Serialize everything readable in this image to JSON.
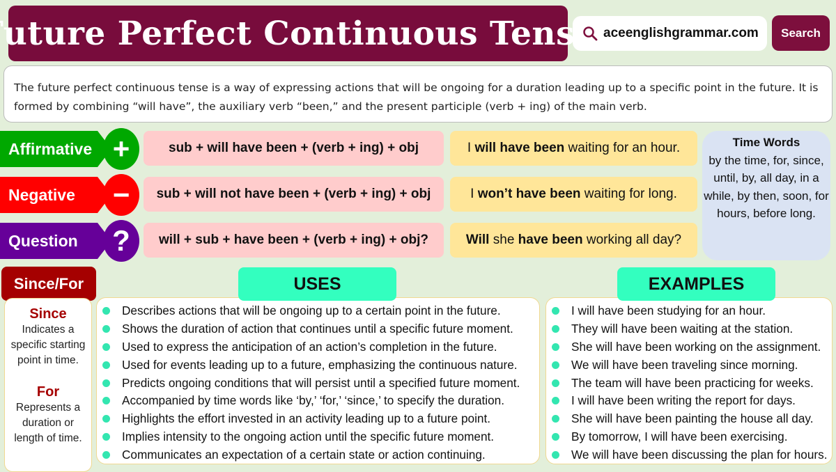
{
  "title": "Future Perfect Continuous Tense",
  "search": {
    "text": "aceenglishgrammar.com",
    "button": "Search",
    "icon": "search-icon"
  },
  "description": "The future perfect continuous tense is a way of expressing actions that will be ongoing for a duration leading up to a specific point in the future. It is formed by combining “will have”, the auxiliary verb “been,” and the present participle (verb + ing) of the main verb.",
  "colors": {
    "title_bg": "#780c3c",
    "affirmative": "#00a800",
    "negative": "#ff0000",
    "question": "#660099",
    "formula_bg": "#ffcccc",
    "example_bg": "#ffe699",
    "section_tab": "#33ffbf",
    "since_for": "#a50000",
    "background": "#e3efda"
  },
  "forms": [
    {
      "label": "Affirmative",
      "symbol": "+",
      "icon": "plus-icon",
      "formula": "sub + will have been + (verb + ing) + obj",
      "example": [
        {
          "t": "I ",
          "b": false
        },
        {
          "t": "will have been",
          "b": true
        },
        {
          "t": " waiting for an hour.",
          "b": false
        }
      ]
    },
    {
      "label": "Negative",
      "symbol": "−",
      "icon": "minus-icon",
      "formula": "sub + will not have been + (verb + ing) + obj",
      "example": [
        {
          "t": "I ",
          "b": false
        },
        {
          "t": "won’t have been",
          "b": true
        },
        {
          "t": " waiting for long.",
          "b": false
        }
      ]
    },
    {
      "label": "Question",
      "symbol": "?",
      "icon": "question-icon",
      "formula": "will + sub + have been + (verb + ing) + obj?",
      "example": [
        {
          "t": "Will",
          "b": true
        },
        {
          "t": " she ",
          "b": false
        },
        {
          "t": "have been",
          "b": true
        },
        {
          "t": " working all day?",
          "b": false
        }
      ]
    }
  ],
  "time_words": {
    "title": "Time Words",
    "text": "by the time, for, since, until, by, all day, in a while, by then, soon, for hours, before long."
  },
  "since_for": {
    "tab": "Since/For",
    "since_title": "Since",
    "since_text": "Indicates a specific starting point in time.",
    "for_title": "For",
    "for_text": "Represents a duration or length of time."
  },
  "uses": {
    "title": "USES",
    "items": [
      "Describes actions that will be ongoing up to a certain point in the future.",
      "Shows the duration of action that continues until a specific future moment.",
      "Used to express the anticipation of an action’s completion in the future.",
      "Used for events leading up to a future, emphasizing the continuous nature.",
      "Predicts ongoing conditions that will persist until a specified future moment.",
      "Accompanied by time words like ‘by,’ ‘for,’ ‘since,’ to specify the duration.",
      "Highlights the effort invested in an activity leading up to a future point.",
      "Implies intensity to the ongoing action until the specific future moment.",
      "Communicates an expectation of a certain state or action continuing."
    ]
  },
  "examples": {
    "title": "EXAMPLES",
    "items": [
      "I will have been studying for an hour.",
      "They will have been waiting at the station.",
      "She will have been working on the assignment.",
      "We will have been traveling since morning.",
      "The team will have been practicing for weeks.",
      "I will have been writing the report for days.",
      "She will have been painting the house all day.",
      "By tomorrow, I will have been exercising.",
      "We will have been discussing the plan for hours."
    ]
  }
}
